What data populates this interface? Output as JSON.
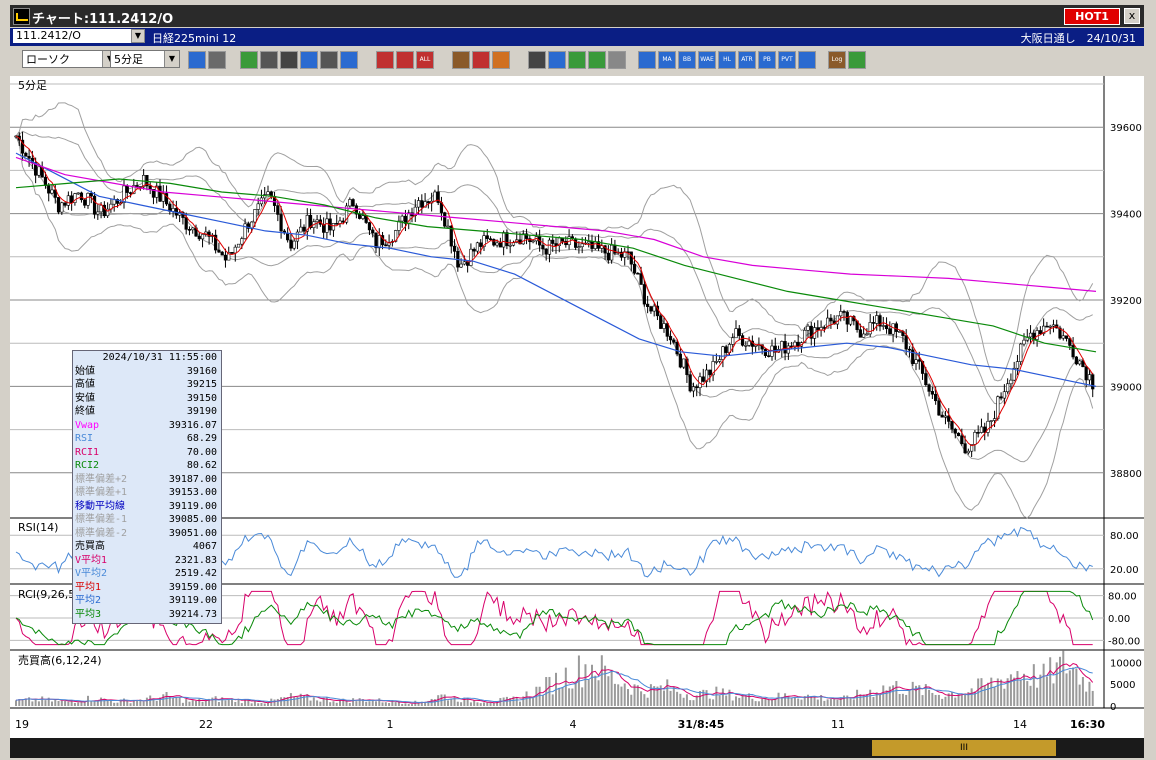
{
  "window": {
    "title": "チャート:111.2412/O",
    "hot_label": "HOT1",
    "close_label": "x"
  },
  "infobar": {
    "symbol": "111.2412/O",
    "instrument": "日経225mini 12",
    "session_date": "大阪日通し　24/10/31"
  },
  "toolbar": {
    "chart_type": "ローソク",
    "timeframe": "5分足",
    "buttons": [
      {
        "icon": "zoom-icon",
        "label": "",
        "color": "#2a6ad0"
      },
      {
        "icon": "grid-icon",
        "label": "",
        "color": "#6a6a6a"
      },
      {
        "icon": "pencil-icon",
        "label": "",
        "color": "#3a9a3a"
      },
      {
        "icon": "link-icon",
        "label": "",
        "color": "#555555"
      },
      {
        "icon": "cursor-icon",
        "label": "",
        "color": "#444444"
      },
      {
        "icon": "arrow-icon",
        "label": "",
        "color": "#2a6ad0"
      },
      {
        "icon": "print-icon",
        "label": "",
        "color": "#555555"
      },
      {
        "icon": "trash-icon",
        "label": "",
        "color": "#2a6ad0"
      },
      {
        "icon": "compress-icon",
        "label": "",
        "color": "#c03030"
      },
      {
        "icon": "expand-icon",
        "label": "",
        "color": "#c03030"
      },
      {
        "icon": "all-icon",
        "label": "ALL",
        "color": "#c03030"
      },
      {
        "icon": "settings-icon",
        "label": "",
        "color": "#8a5a2a"
      },
      {
        "icon": "brush-icon",
        "label": "",
        "color": "#c03030"
      },
      {
        "icon": "palette-icon",
        "label": "",
        "color": "#d07020"
      },
      {
        "icon": "candle-icon",
        "label": "",
        "color": "#444444"
      },
      {
        "icon": "search-icon",
        "label": "",
        "color": "#2a6ad0"
      },
      {
        "icon": "text-icon",
        "label": "",
        "color": "#3a9a3a"
      },
      {
        "icon": "scale-icon",
        "label": "",
        "color": "#3a9a3a"
      },
      {
        "icon": "lock-icon",
        "label": "",
        "color": "#888888"
      },
      {
        "icon": "average-icon",
        "label": "",
        "color": "#2a6ad0"
      },
      {
        "icon": "ma-icon",
        "label": "MA",
        "color": "#2a6ad0"
      },
      {
        "icon": "bb-icon",
        "label": "BB",
        "color": "#2a6ad0"
      },
      {
        "icon": "wave-icon",
        "label": "WAE",
        "color": "#2a6ad0"
      },
      {
        "icon": "hl-icon",
        "label": "HL",
        "color": "#2a6ad0"
      },
      {
        "icon": "atr-icon",
        "label": "ATR",
        "color": "#2a6ad0"
      },
      {
        "icon": "pbs-icon",
        "label": "PB",
        "color": "#2a6ad0"
      },
      {
        "icon": "pvt-icon",
        "label": "PVT",
        "color": "#2a6ad0"
      },
      {
        "icon": "window-icon",
        "label": "",
        "color": "#2a6ad0"
      },
      {
        "icon": "log-icon",
        "label": "Log",
        "color": "#8a5a2a"
      },
      {
        "icon": "window-split-icon",
        "label": "",
        "color": "#3a9a3a"
      }
    ]
  },
  "panels": {
    "main_label": "5分足",
    "rsi_label": "RSI(14)",
    "rci_label": "RCI(9,26,52)",
    "volume_label": "売買高(6,12,24)"
  },
  "price_axis": [
    "39600",
    "39400",
    "39200",
    "39000",
    "38800"
  ],
  "rsi_axis": [
    "80.00",
    "20.00"
  ],
  "rci_axis": [
    "80.00",
    "0.00",
    "-80.00"
  ],
  "volume_axis": [
    "10000",
    "5000",
    "0"
  ],
  "time_axis": [
    "19",
    "22",
    "1",
    "4",
    "31/8:45",
    "11",
    "14",
    "16:30"
  ],
  "data_window": {
    "datetime": "2024/10/31  11:55:00",
    "rows": [
      {
        "label": "始値",
        "value": "39160",
        "color": "#000000"
      },
      {
        "label": "高値",
        "value": "39215",
        "color": "#000000"
      },
      {
        "label": "安値",
        "value": "39150",
        "color": "#000000"
      },
      {
        "label": "終値",
        "value": "39190",
        "color": "#000000"
      },
      {
        "label": "Vwap",
        "value": "39316.07",
        "color": "#ff00ff"
      },
      {
        "label": "RSI",
        "value": "68.29",
        "color": "#4a8ad8"
      },
      {
        "label": "RCI1",
        "value": "70.00",
        "color": "#d8006a"
      },
      {
        "label": "RCI2",
        "value": "80.62",
        "color": "#0a8a0a"
      },
      {
        "label": "標準偏差+2",
        "value": "39187.00",
        "color": "#a0a0a0"
      },
      {
        "label": "標準偏差+1",
        "value": "39153.00",
        "color": "#a0a0a0"
      },
      {
        "label": "移動平均線",
        "value": "39119.00",
        "color": "#0000c0"
      },
      {
        "label": "標準偏差-1",
        "value": "39085.00",
        "color": "#a0a0a0"
      },
      {
        "label": "標準偏差-2",
        "value": "39051.00",
        "color": "#a0a0a0"
      },
      {
        "label": "売買高",
        "value": "4067",
        "color": "#000000"
      },
      {
        "label": "V平均1",
        "value": "2321.83",
        "color": "#d8006a"
      },
      {
        "label": "V平均2",
        "value": "2519.42",
        "color": "#4a8ad8"
      },
      {
        "label": "平均1",
        "value": "39159.00",
        "color": "#d80000"
      },
      {
        "label": "平均2",
        "value": "39119.00",
        "color": "#2a6ad0"
      },
      {
        "label": "平均3",
        "value": "39214.73",
        "color": "#0a8a0a"
      }
    ]
  },
  "scrollbar": {
    "thumb_label": "III"
  },
  "chart_data": {
    "type": "line",
    "title": "",
    "ylim": [
      38700,
      39700
    ],
    "x_ticks": [
      "19",
      "22",
      "1",
      "4",
      "31/8:45",
      "11",
      "14",
      "16:30"
    ],
    "price_keypoints": [
      39580,
      39500,
      39420,
      39450,
      39400,
      39440,
      39480,
      39430,
      39380,
      39350,
      39290,
      39380,
      39440,
      39330,
      39390,
      39360,
      39430,
      39330,
      39360,
      39430,
      39440,
      39280,
      39330,
      39340,
      39350,
      39320,
      39330,
      39320,
      39310,
      39300,
      39180,
      39120,
      39000,
      39040,
      39120,
      39100,
      39080,
      39110,
      39140,
      39160,
      39130,
      39150,
      39110,
      39020,
      38920,
      38860,
      38900,
      39020,
      39120,
      39150,
      39090,
      39010
    ],
    "series": [
      {
        "name": "移動平均線",
        "color": "#2a5ad8",
        "values": [
          39540,
          39490,
          39440,
          39420,
          39400,
          39380,
          39360,
          39350,
          39330,
          39320,
          39300,
          39290,
          39260,
          39210,
          39160,
          39110,
          39080,
          39070,
          39080,
          39090,
          39100,
          39090,
          39070,
          39050,
          39040,
          39020,
          39000
        ]
      },
      {
        "name": "Vwap",
        "color": "#d800d8",
        "values": [
          39530,
          39490,
          39470,
          39450,
          39440,
          39430,
          39420,
          39410,
          39400,
          39390,
          39380,
          39370,
          39360,
          39340,
          39300,
          39280,
          39270,
          39260,
          39255,
          39250,
          39240,
          39230,
          39220
        ]
      },
      {
        "name": "平均3",
        "color": "#0a8a0a",
        "values": [
          39460,
          39470,
          39480,
          39470,
          39450,
          39440,
          39420,
          39390,
          39370,
          39360,
          39350,
          39340,
          39320,
          39280,
          39250,
          39220,
          39200,
          39180,
          39160,
          39140,
          39100,
          39080
        ]
      }
    ],
    "volume_pattern": [
      1200,
      1500,
      900,
      1800,
      1100,
      1400,
      2200,
      1000,
      1600,
      1300,
      900,
      2100,
      1700,
      1200,
      1500,
      1000,
      800,
      2400,
      1300,
      1100,
      1600,
      4000,
      7000,
      9500,
      6000,
      3500,
      4200,
      2500,
      3000,
      2200,
      1800,
      2600,
      2000,
      1500,
      3200,
      4500,
      3800,
      2600,
      3500,
      5200,
      7800,
      6500,
      9800,
      4100
    ]
  }
}
